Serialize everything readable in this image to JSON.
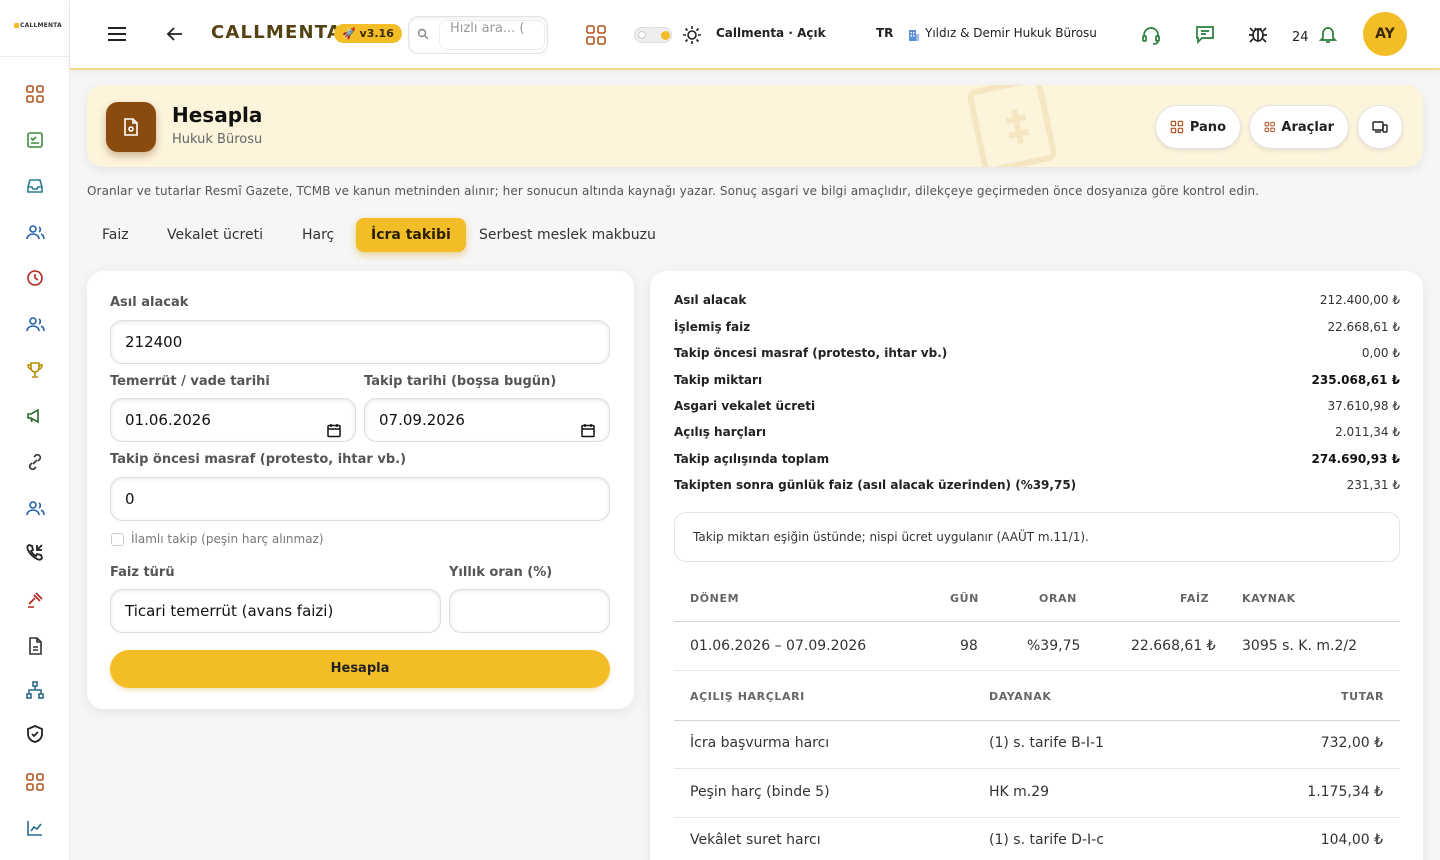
{
  "sidebar": {
    "logo_text": "CALLMENTA",
    "icons": [
      "grid-icon",
      "checklist-icon",
      "inbox-icon",
      "users-icon",
      "clock-icon",
      "user-group-icon",
      "trophy-icon",
      "megaphone-icon",
      "link-icon",
      "contacts-icon",
      "phone-incoming-icon",
      "gavel-icon",
      "document-icon",
      "org-chart-icon",
      "shield-check-icon",
      "apps-icon",
      "chart-line-icon"
    ]
  },
  "header": {
    "brand": "CALLMENTA",
    "version": "v3.16",
    "search_placeholder": "Hızlı ara... (",
    "workspace_status": "Callmenta · Açık",
    "language": "TR",
    "firm_name": "Yıldız & Demir Hukuk Bürosu",
    "notification_count": "24",
    "avatar_initials": "AY",
    "accent_color": "#f2bd26"
  },
  "page": {
    "title": "Hesapla",
    "subtitle": "Hukuk Bürosu",
    "buttons": {
      "pano": "Pano",
      "araclar": "Araçlar"
    },
    "notice": "Oranlar ve tutarlar Resmî Gazete, TCMB ve kanun metninden alınır; her sonucun altında kaynağı yazar. Sonuç asgari ve bilgi amaçlıdır, dilekçeye geçirmeden önce dosyanıza göre kontrol edin.",
    "tabs": [
      "Faiz",
      "Vekalet ücreti",
      "Harç",
      "İcra takibi",
      "Serbest meslek makbuzu"
    ],
    "active_tab": "İcra takibi"
  },
  "form": {
    "principal_label": "Asıl alacak",
    "principal_value": "212400",
    "default_date_label": "Temerrüt / vade tarihi",
    "default_date_value": "01.06.2026",
    "follow_date_label": "Takip tarihi (boşsa bugün)",
    "follow_date_value": "07.09.2026",
    "expense_label": "Takip öncesi masraf (protesto, ihtar vb.)",
    "expense_value": "0",
    "ilamli_label": "İlamlı takip (peşin harç alınmaz)",
    "interest_type_label": "Faiz türü",
    "interest_type_value": "Ticari temerrüt (avans faizi)",
    "annual_rate_label": "Yıllık oran (%)",
    "annual_rate_value": "",
    "submit_label": "Hesapla"
  },
  "summary": [
    {
      "label": "Asıl alacak",
      "value": "212.400,00 ₺"
    },
    {
      "label": "İşlemiş faiz",
      "value": "22.668,61 ₺"
    },
    {
      "label": "Takip öncesi masraf (protesto, ihtar vb.)",
      "value": "0,00 ₺"
    },
    {
      "label": "Takip miktarı",
      "value": "235.068,61 ₺",
      "strong": true
    },
    {
      "label": "Asgari vekalet ücreti",
      "value": "37.610,98 ₺"
    },
    {
      "label": "Açılış harçları",
      "value": "2.011,34 ₺"
    },
    {
      "label": "Takip açılışında toplam",
      "value": "274.690,93 ₺",
      "strong": true
    },
    {
      "label": "Takipten sonra günlük faiz (asıl alacak üzerinden) (%39,75)",
      "value": "231,31 ₺"
    }
  ],
  "info_note": "Takip miktarı eşiğin üstünde; nispi ücret uygulanır (AAÜT m.11/1).",
  "period_table": {
    "headers": [
      "DÖNEM",
      "GÜN",
      "ORAN",
      "FAİZ",
      "KAYNAK"
    ],
    "rows": [
      [
        "01.06.2026 – 07.09.2026",
        "98",
        "%39,75",
        "22.668,61 ₺",
        "3095 s. K. m.2/2"
      ]
    ]
  },
  "fee_table": {
    "headers": [
      "AÇILIŞ HARÇLARI",
      "DAYANAK",
      "TUTAR"
    ],
    "rows": [
      [
        "İcra başvurma harcı",
        "(1) s. tarife B-I-1",
        "732,00 ₺"
      ],
      [
        "Peşin harç (binde 5)",
        "HK m.29",
        "1.175,34 ₺"
      ],
      [
        "Vekâlet suret harcı",
        "(1) s. tarife D-I-c",
        "104,00 ₺"
      ]
    ]
  }
}
